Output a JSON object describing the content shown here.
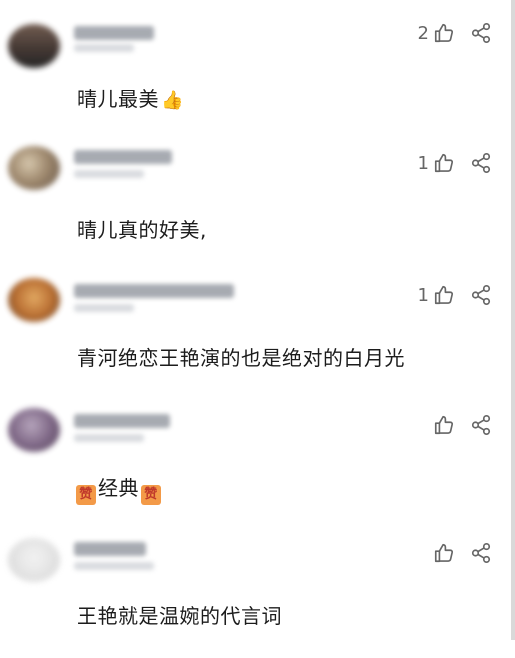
{
  "comments": [
    {
      "like_count": "2",
      "text": "晴儿最美",
      "emoji": "👍"
    },
    {
      "like_count": "1",
      "text": "晴儿真的好美,"
    },
    {
      "like_count": "1",
      "text": "青河绝恋王艳演的也是绝对的白月光"
    },
    {
      "like_count": "",
      "text_prefix_icon": "赞",
      "text": "经典",
      "text_suffix_icon": "赞"
    },
    {
      "like_count": "",
      "text": "王艳就是温婉的代言词"
    }
  ],
  "icons": {
    "like": "thumbs-up-outline-icon",
    "share": "share-nodes-icon"
  },
  "colors": {
    "text": "#1c1c1c",
    "meta": "#666666",
    "zan_bg": "#f39a48"
  }
}
